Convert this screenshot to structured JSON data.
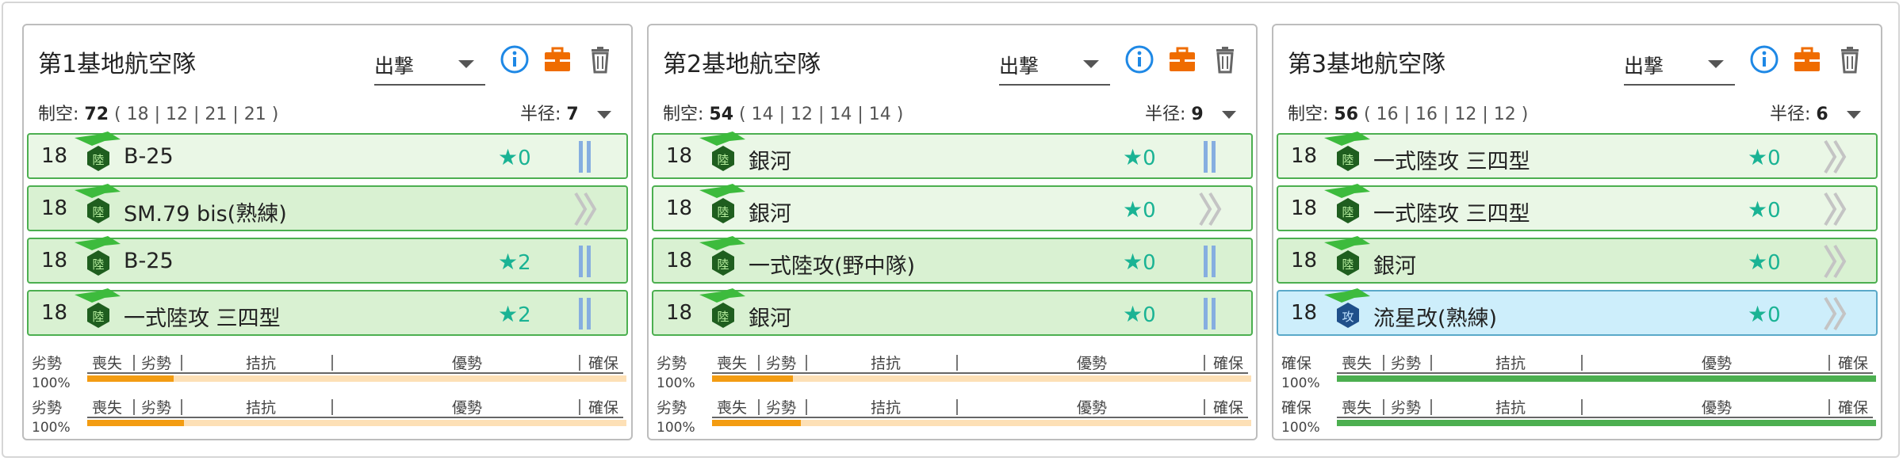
{
  "bases": [
    {
      "title": "第1基地航空隊",
      "mode": "出撃",
      "air_label": "制空:",
      "air_value": "72",
      "air_detail": "( 18 | 12 | 21 | 21 )",
      "radius_label": "半径:",
      "radius_value": "7",
      "slots": [
        {
          "count": "18",
          "name": "B-25",
          "prof": "0",
          "skill_icon": "skill-bars-icon",
          "type": "陸"
        },
        {
          "count": "18",
          "name": "SM.79 bis(熟練)",
          "prof": "",
          "skill_icon": "skill-chevron-icon",
          "type": "陸"
        },
        {
          "count": "18",
          "name": "B-25",
          "prof": "2",
          "skill_icon": "skill-bars-icon",
          "type": "陸"
        },
        {
          "count": "18",
          "name": "一式陸攻 三四型",
          "prof": "2",
          "skill_icon": "skill-bars-icon",
          "type": "陸"
        }
      ],
      "wave_left_label": "劣勢",
      "wave_pct": "100%",
      "wave1_fraction": 0.16,
      "wave2_fraction": 0.18
    },
    {
      "title": "第2基地航空隊",
      "mode": "出撃",
      "air_label": "制空:",
      "air_value": "54",
      "air_detail": "( 14 | 12 | 14 | 14 )",
      "radius_label": "半径:",
      "radius_value": "9",
      "slots": [
        {
          "count": "18",
          "name": "銀河",
          "prof": "0",
          "skill_icon": "skill-bars-icon",
          "type": "陸"
        },
        {
          "count": "18",
          "name": "銀河",
          "prof": "0",
          "skill_icon": "skill-chevron-icon",
          "type": "陸"
        },
        {
          "count": "18",
          "name": "一式陸攻(野中隊)",
          "prof": "0",
          "skill_icon": "skill-bars-icon",
          "type": "陸"
        },
        {
          "count": "18",
          "name": "銀河",
          "prof": "0",
          "skill_icon": "skill-bars-icon",
          "type": "陸"
        }
      ],
      "wave_left_label": "劣勢",
      "wave_pct": "100%",
      "wave1_fraction": 0.15,
      "wave2_fraction": 0.165
    },
    {
      "title": "第3基地航空隊",
      "mode": "出撃",
      "air_label": "制空:",
      "air_value": "56",
      "air_detail": "( 16 | 16 | 12 | 12 )",
      "radius_label": "半径:",
      "radius_value": "6",
      "slots": [
        {
          "count": "18",
          "name": "一式陸攻 三四型",
          "prof": "0",
          "skill_icon": "skill-chevron-icon",
          "type": "陸"
        },
        {
          "count": "18",
          "name": "一式陸攻 三四型",
          "prof": "0",
          "skill_icon": "skill-chevron-icon",
          "type": "陸"
        },
        {
          "count": "18",
          "name": "銀河",
          "prof": "0",
          "skill_icon": "skill-chevron-icon",
          "type": "陸"
        },
        {
          "count": "18",
          "name": "流星改(熟練)",
          "prof": "0",
          "skill_icon": "skill-chevron-icon",
          "type": "攻"
        }
      ],
      "wave_left_label": "確保",
      "wave_pct": "100%",
      "wave1_fraction": 1.0,
      "wave2_fraction": 1.0
    }
  ],
  "air_states": [
    "喪失",
    "劣勢",
    "拮抗",
    "優勢",
    "確保"
  ],
  "colors": {
    "slot_border": "#4caf50",
    "fighter_bg": "#cdeefb",
    "proficiency": "#1ab394",
    "inferiority": "#f39c12",
    "supremacy": "#4caf50",
    "info_icon": "#1e88e5",
    "case_icon": "#ef6c00"
  },
  "icons": {
    "info": "info-icon",
    "case": "briefcase-icon",
    "trash": "trash-icon",
    "plane": "land-plane-icon"
  }
}
